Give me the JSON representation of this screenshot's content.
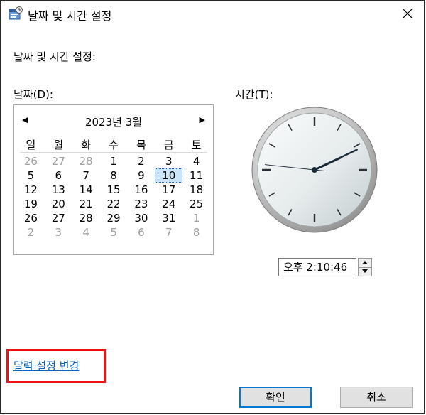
{
  "window": {
    "title": "날짜 및 시간 설정",
    "close_glyph": "✕"
  },
  "heading": "날짜 및 시간 설정:",
  "date_label": "날짜(D):",
  "time_label": "시간(T):",
  "calendar": {
    "prev_glyph": "◀",
    "next_glyph": "▶",
    "month_title": "2023년 3월",
    "weekdays": [
      "일",
      "월",
      "화",
      "수",
      "목",
      "금",
      "토"
    ],
    "weeks": [
      [
        "26",
        "27",
        "28",
        "1",
        "2",
        "3",
        "4"
      ],
      [
        "5",
        "6",
        "7",
        "8",
        "9",
        "10",
        "11"
      ],
      [
        "12",
        "13",
        "14",
        "15",
        "16",
        "17",
        "18"
      ],
      [
        "19",
        "20",
        "21",
        "22",
        "23",
        "24",
        "25"
      ],
      [
        "26",
        "27",
        "28",
        "29",
        "30",
        "31",
        "1"
      ],
      [
        "2",
        "3",
        "4",
        "5",
        "6",
        "7",
        "8"
      ]
    ],
    "selected_day": "10"
  },
  "clock": {
    "hours": 14,
    "minutes": 10,
    "seconds": 46
  },
  "time_field": {
    "value": "오후   2:10:46"
  },
  "calendar_settings_link": "달력 설정 변경",
  "buttons": {
    "ok": "확인",
    "cancel": "취소"
  },
  "colors": {
    "link": "#0563c1",
    "highlight_box": "#ee1111",
    "selected_day_bg": "#cce4f7",
    "default_button_border": "#0078d7"
  }
}
